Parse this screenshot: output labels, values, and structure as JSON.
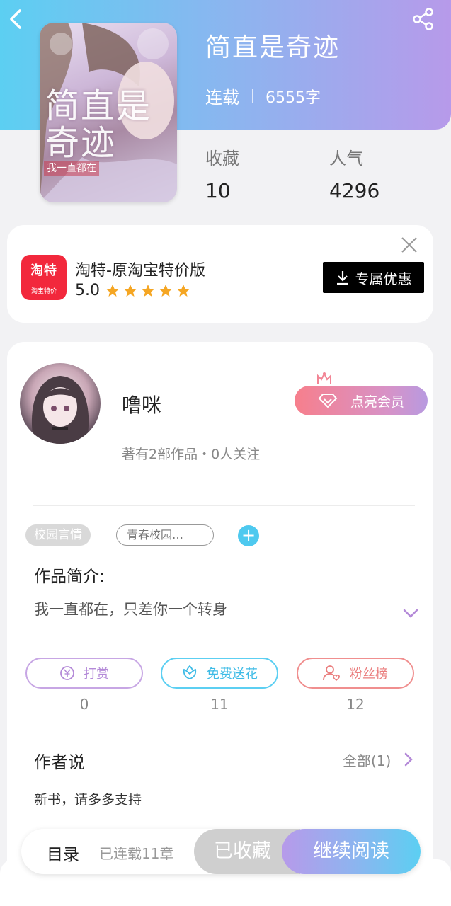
{
  "book": {
    "title": "简直是奇迹",
    "status": "连载",
    "word_count": "6555字",
    "cover_title": "简直是奇迹",
    "cover_subtitle": "我一直都在",
    "stats": {
      "favorites_label": "收藏",
      "favorites_value": "10",
      "popularity_label": "人气",
      "popularity_value": "4296"
    }
  },
  "ad": {
    "logo_text": "淘特",
    "logo_subtext": "淘宝特价",
    "app_name": "淘特-原淘宝特价版",
    "rating": "5.0",
    "stars": 5,
    "button_label": "专属优惠",
    "star_color": "#f5a623"
  },
  "author": {
    "name": "噜咪",
    "vip_button": "点亮会员",
    "meta": "著有2部作品・0人关注"
  },
  "tags": {
    "genre": "校园言情",
    "custom": "青春校园…",
    "add_symbol": "+"
  },
  "intro": {
    "label": "作品简介:",
    "text": "我一直都在，只差你一个转身"
  },
  "actions": [
    {
      "label": "打赏",
      "count": "0"
    },
    {
      "label": "免费送花",
      "count": "11"
    },
    {
      "label": "粉丝榜",
      "count": "12"
    }
  ],
  "author_says": {
    "title": "作者说",
    "all_label": "全部(1)",
    "text": "新书，请多多支持"
  },
  "bottom_bar": {
    "toc_label": "目录",
    "toc_progress": "已连载11章",
    "collected_label": "已收藏",
    "read_label": "继续阅读"
  },
  "colors": {
    "accent_blue": "#5ccff2",
    "accent_purple": "#b79aea",
    "vip_pink": "#f77f8c"
  }
}
